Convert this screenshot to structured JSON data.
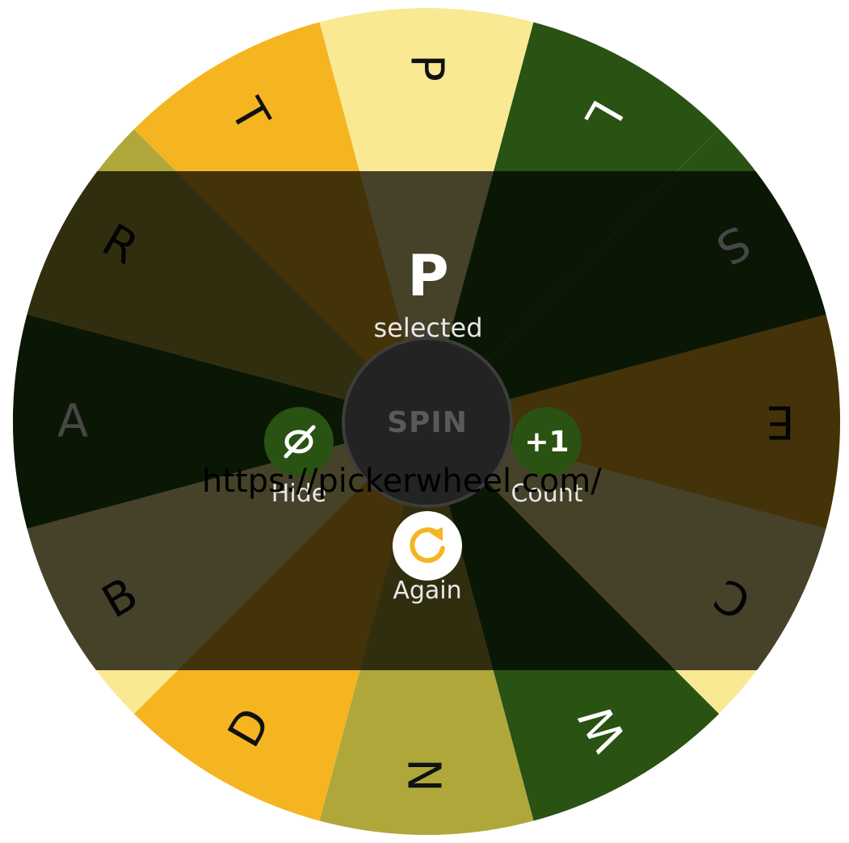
{
  "wheel": {
    "segments": [
      {
        "label": "P",
        "color": "#f9e993"
      },
      {
        "label": "L",
        "color": "#2a5213"
      },
      {
        "label": "S",
        "color": "#2a5213"
      },
      {
        "label": "E",
        "color": "#f5b521"
      },
      {
        "label": "C",
        "color": "#f9e993"
      },
      {
        "label": "W",
        "color": "#2a5213"
      },
      {
        "label": "N",
        "color": "#b0a73b"
      },
      {
        "label": "D",
        "color": "#f5b521"
      },
      {
        "label": "B",
        "color": "#f9e993"
      },
      {
        "label": "A",
        "color": "#2a5213"
      },
      {
        "label": "R",
        "color": "#b0a73b"
      },
      {
        "label": "T",
        "color": "#f5b521"
      }
    ],
    "dark_label_color": "#111111",
    "light_label_color": "#ffffff"
  },
  "result": {
    "value": "P",
    "caption": "selected"
  },
  "controls": {
    "spin_label": "SPIN",
    "hide_label": "Hide",
    "count_badge": "+1",
    "count_label": "Count",
    "again_label": "Again",
    "hide_icon": "eye-slash-icon",
    "again_icon": "refresh-icon"
  },
  "colors": {
    "overlay": "rgba(0,0,0,0.72)",
    "button_green": "#2a5213",
    "accent_orange": "#f5b521"
  },
  "watermark": "https://pickerwheel.com/"
}
